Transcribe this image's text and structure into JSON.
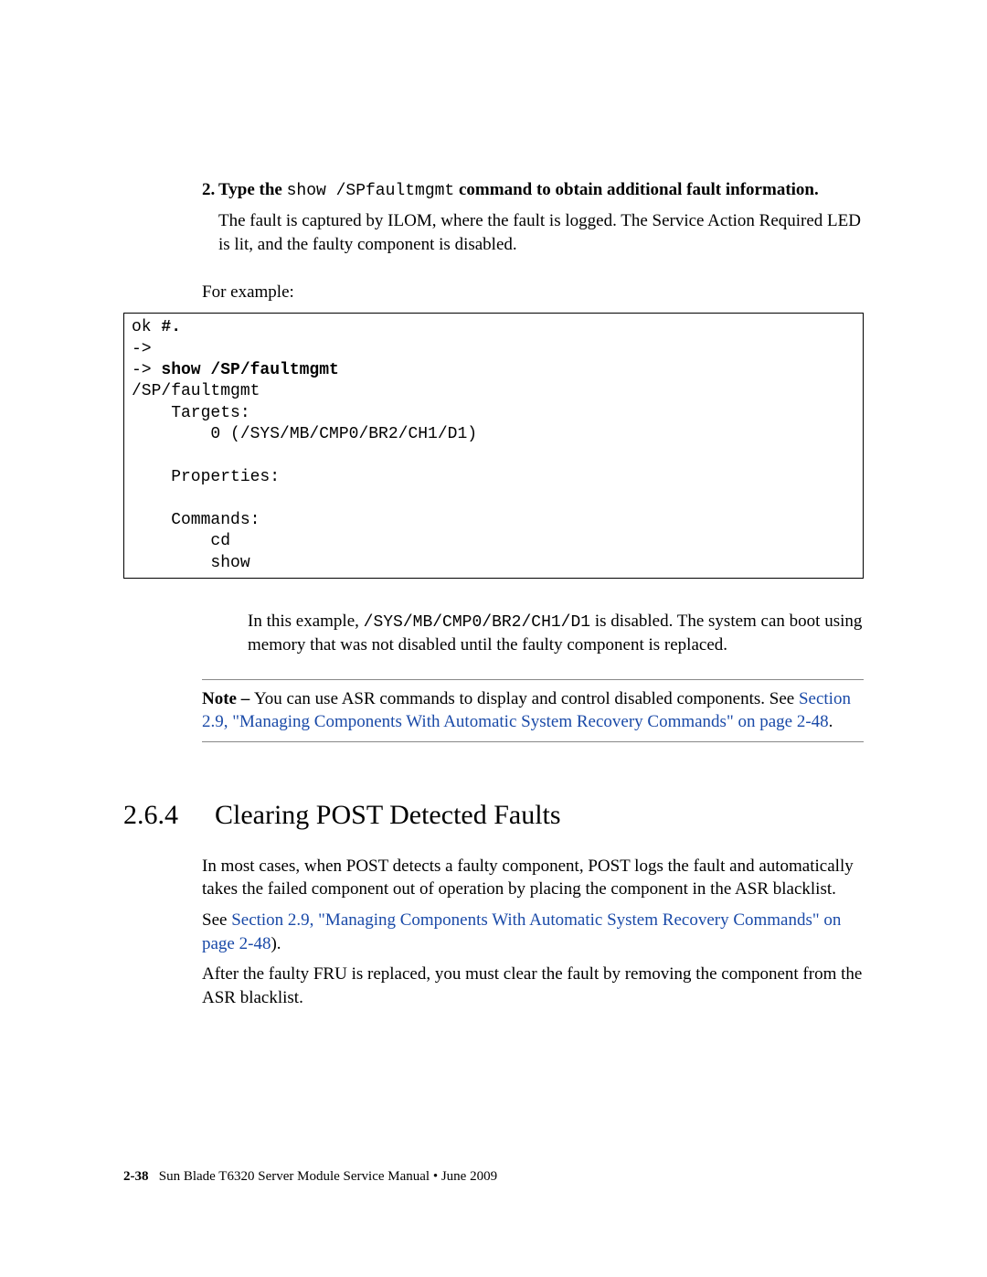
{
  "step": {
    "number": "2.",
    "prefix": "Type the ",
    "cmd": "show /SPfaultmgmt",
    "suffix": " command to obtain additional fault information."
  },
  "captured": "The fault is captured by ILOM, where the fault is logged. The Service Action Required LED is lit, and the faulty component is disabled.",
  "for_example": "For example:",
  "code": {
    "l1a": "ok ",
    "l1b": "#.",
    "l2": "->",
    "l3a": "-> ",
    "l3b": "show /SP/faultmgmt",
    "l4": "/SP/faultmgmt",
    "l5": "    Targets:",
    "l6": "        0 (/SYS/MB/CMP0/BR2/CH1/D1)",
    "l7": "",
    "l8": "    Properties:",
    "l9": "",
    "l10": "    Commands:",
    "l11": "        cd",
    "l12": "        show"
  },
  "after_code": {
    "pre": "In this example, ",
    "path": "/SYS/MB/CMP0/BR2/CH1/D1",
    "post": " is disabled. The system can boot using memory that was not disabled until the faulty component is replaced."
  },
  "note": {
    "label": "Note – ",
    "pre": "You can use ASR commands to display and control disabled components. See ",
    "link": "Section 2.9, \"Managing Components With Automatic System Recovery Commands\" on page 2-48",
    "post": "."
  },
  "section": {
    "num": "2.6.4",
    "title": "Clearing POST Detected Faults"
  },
  "p1": "In most cases, when POST detects a faulty component, POST logs the fault and automatically takes the failed component out of operation by placing the component in the ASR blacklist.",
  "p2": {
    "pre": "See ",
    "link": "Section 2.9, \"Managing Components With Automatic System Recovery Commands\" on page 2-48",
    "post": ")."
  },
  "p3": "After the faulty FRU is replaced, you must clear the fault by removing the component from the ASR blacklist.",
  "footer": {
    "pagenum": "2-38",
    "text": "Sun Blade T6320 Server Module Service Manual • June 2009"
  }
}
